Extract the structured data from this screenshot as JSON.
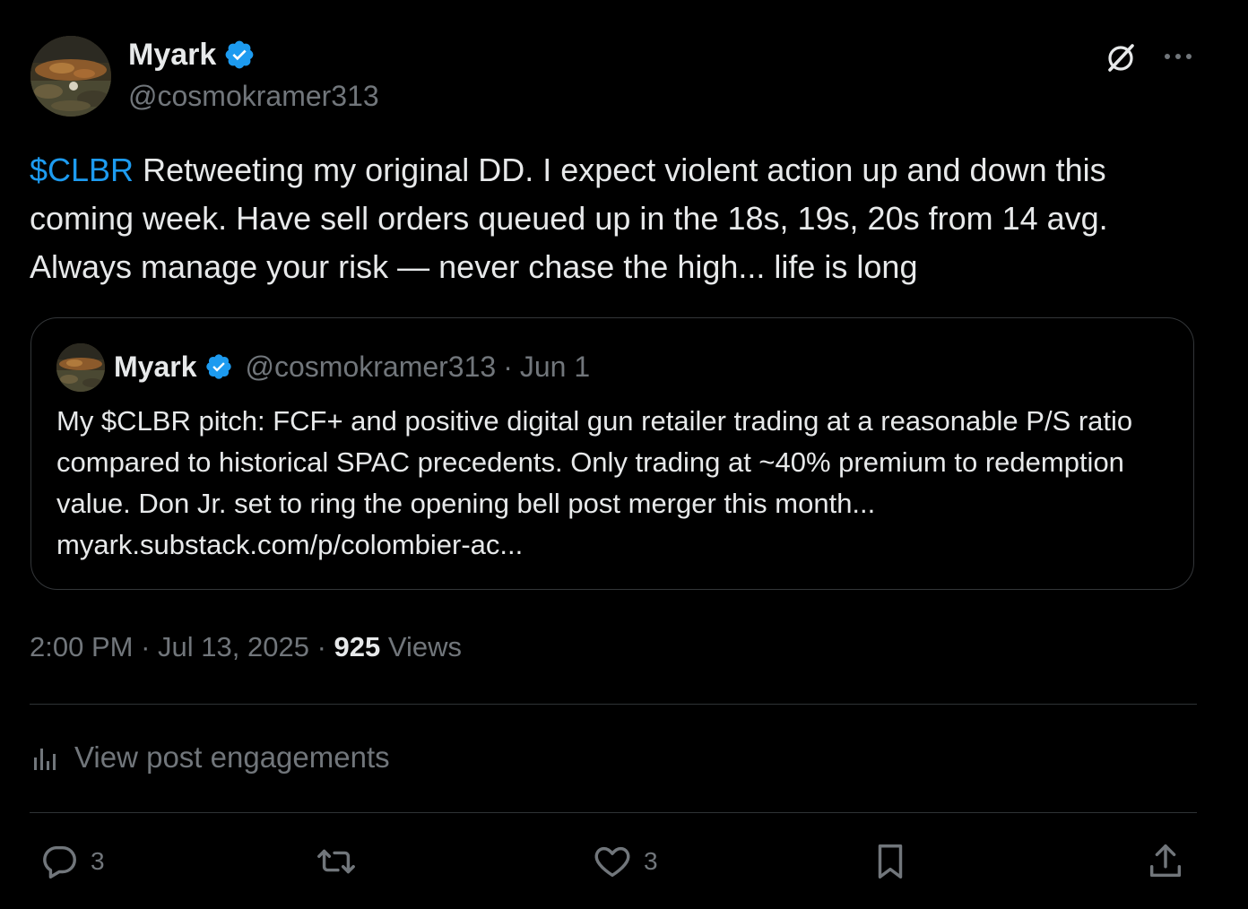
{
  "author": {
    "display_name": "Myark",
    "handle": "@cosmokramer313",
    "verified": true
  },
  "tweet": {
    "cashtag": "$CLBR",
    "text": " Retweeting my original DD. I expect violent action up and down this coming week. Have sell orders queued up in the 18s, 19s, 20s from 14 avg. Always manage your risk — never chase the high... life is long"
  },
  "quoted": {
    "display_name": "Myark",
    "handle": "@cosmokramer313",
    "separator": "·",
    "date": "Jun 1",
    "text": "My $CLBR pitch: FCF+ and positive digital gun retailer trading at a reasonable P/S ratio compared to historical SPAC precedents. Only trading at ~40% premium to redemption value. Don Jr. set to ring the opening bell post merger this month...  myark.substack.com/p/colombier-ac..."
  },
  "meta": {
    "time": "2:00 PM",
    "date": "Jul 13, 2025",
    "separator": "·",
    "views_count": "925",
    "views_label": "Views"
  },
  "engagements_link": "View post engagements",
  "actions": {
    "replies": "3",
    "likes": "3"
  },
  "icons": {
    "verified": "verified-badge-icon",
    "grok": "grok-icon",
    "more": "more-dots-icon",
    "analytics": "analytics-icon",
    "reply": "reply-icon",
    "repost": "repost-icon",
    "like": "heart-icon",
    "bookmark": "bookmark-icon",
    "share": "share-icon"
  },
  "colors": {
    "background": "#000000",
    "accent": "#1d9bf0",
    "text": "#e7e9ea",
    "muted": "#71767b",
    "border": "#2f3336"
  }
}
